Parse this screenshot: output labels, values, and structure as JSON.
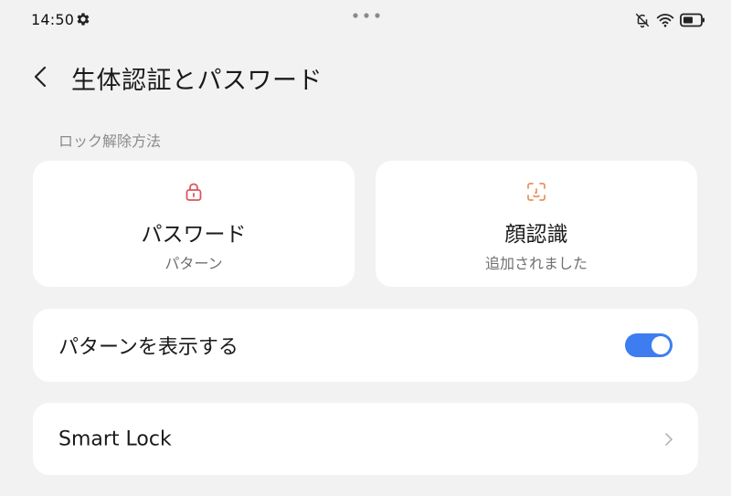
{
  "status_bar": {
    "time": "14:50",
    "icons": [
      "gear-icon",
      "more-dots-icon",
      "bell-off-icon",
      "wifi-icon",
      "battery-icon"
    ]
  },
  "header": {
    "title": "生体認証とパスワード",
    "back_icon": "back-chevron-icon"
  },
  "unlock_section": {
    "label": "ロック解除方法",
    "methods": [
      {
        "title": "パスワード",
        "subtitle": "パターン",
        "icon": "lock-icon",
        "icon_color": "#e0525c"
      },
      {
        "title": "顔認識",
        "subtitle": "追加されました",
        "icon": "face-scan-icon",
        "icon_color": "#e8905a"
      }
    ]
  },
  "settings": {
    "show_pattern": {
      "label": "パターンを表示する",
      "enabled": true
    },
    "smart_lock": {
      "label": "Smart Lock",
      "icon": "chevron-right-icon"
    }
  },
  "colors": {
    "background": "#f2f2f2",
    "card": "#ffffff",
    "accent": "#3d7df0",
    "secondary_text": "#8a8a8a"
  }
}
